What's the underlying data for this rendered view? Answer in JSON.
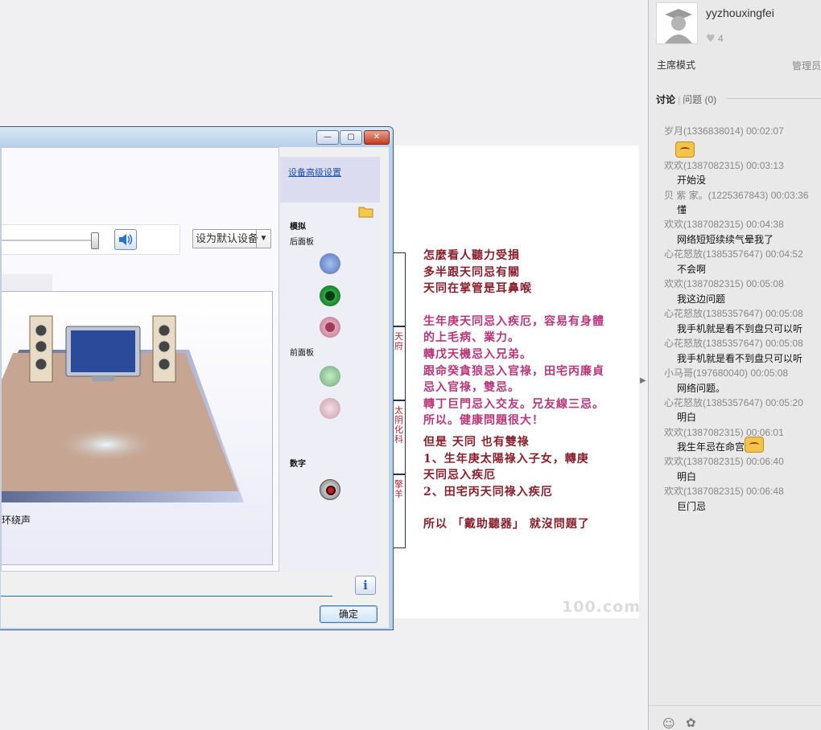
{
  "dialog": {
    "titlebar_buttons": {
      "minimize": "—",
      "maximize": "▢",
      "close": "✕"
    },
    "default_device_label": "设为默认设备",
    "surround_label": "环绕声",
    "ok_label": "确定",
    "info_symbol": "i",
    "jacks": {
      "advanced_link": "设备高级设置",
      "analog_label": "模拟",
      "rear_panel_label": "后面板",
      "front_panel_label": "前面板",
      "digital_label": "数字",
      "colors": {
        "blue": "#6d8fd6",
        "green": "#1f9a2c",
        "pink": "#e5a0b4",
        "green_dim": "#8fc99a",
        "pink_dim": "#e9c2cd",
        "red": "#c21d1d"
      }
    }
  },
  "slide": {
    "side_tabs": [
      "天府",
      "太阴化科",
      "擎羊"
    ],
    "lines_red": [
      "怎麼看人聽力受損",
      "多半跟天同忌有關",
      "天同在掌管是耳鼻喉"
    ],
    "lines_pink": [
      "生年庚天同忌入疾厄，容易有身體",
      "的上毛病、業力。",
      "轉戊天機忌入兄弟。",
      "跟命癸貪狼忌入官祿，田宅丙廉貞",
      "忌入官祿，雙忌。",
      "轉丁巨門忌入交友。兄友線三忌。",
      "所以。健康問題很大！"
    ],
    "lines_red2": [
      "但是 天同 也有雙祿",
      "1、生年庚太陽祿入子女，轉庚",
      "天同忌入疾厄",
      "2、田宅丙天同祿入疾厄"
    ],
    "final_line": "所以 「戴助聽器」 就沒問題了",
    "watermark": "100.com",
    "next_arrow": "▶"
  },
  "sidebar": {
    "username": "yyzhouxingfei",
    "likes": "4",
    "host_mode": "主席模式",
    "admin": "管理员",
    "tab_discuss": "讨论",
    "tab_questions": "问题",
    "questions_count": "(0)",
    "messages": [
      {
        "head": "岁月(1336838014) 00:02:07",
        "body": "",
        "emoji": true
      },
      {
        "head": "欢欢(1387082315) 00:03:13",
        "body": "开始没"
      },
      {
        "head": "贝 紫 家。(1225367843) 00:03:36",
        "body": "懂"
      },
      {
        "head": "欢欢(1387082315) 00:04:38",
        "body": "网络短短续续气晕我了"
      },
      {
        "head": "心花怒放(1385357647) 00:04:52",
        "body": "不会啊"
      },
      {
        "head": "欢欢(1387082315) 00:05:08",
        "body": "我这边问题"
      },
      {
        "head": "心花怒放(1385357647) 00:05:08",
        "body": "我手机就是看不到盘只可以听"
      },
      {
        "head": "心花怒放(1385357647) 00:05:08",
        "body": "我手机就是看不到盘只可以听"
      },
      {
        "head": "小马哥(197680040) 00:05:08",
        "body": "网络问题。"
      },
      {
        "head": "心花怒放(1385357647) 00:05:20",
        "body": "明白"
      },
      {
        "head": "欢欢(1387082315) 00:06:01",
        "body": "我生年忌在命宫",
        "emoji_after": true
      },
      {
        "head": "欢欢(1387082315) 00:06:40",
        "body": "明白"
      },
      {
        "head": "欢欢(1387082315) 00:06:48",
        "body": "巨门忌"
      }
    ],
    "footer_icons": [
      "smiley-icon",
      "flower-icon"
    ]
  }
}
